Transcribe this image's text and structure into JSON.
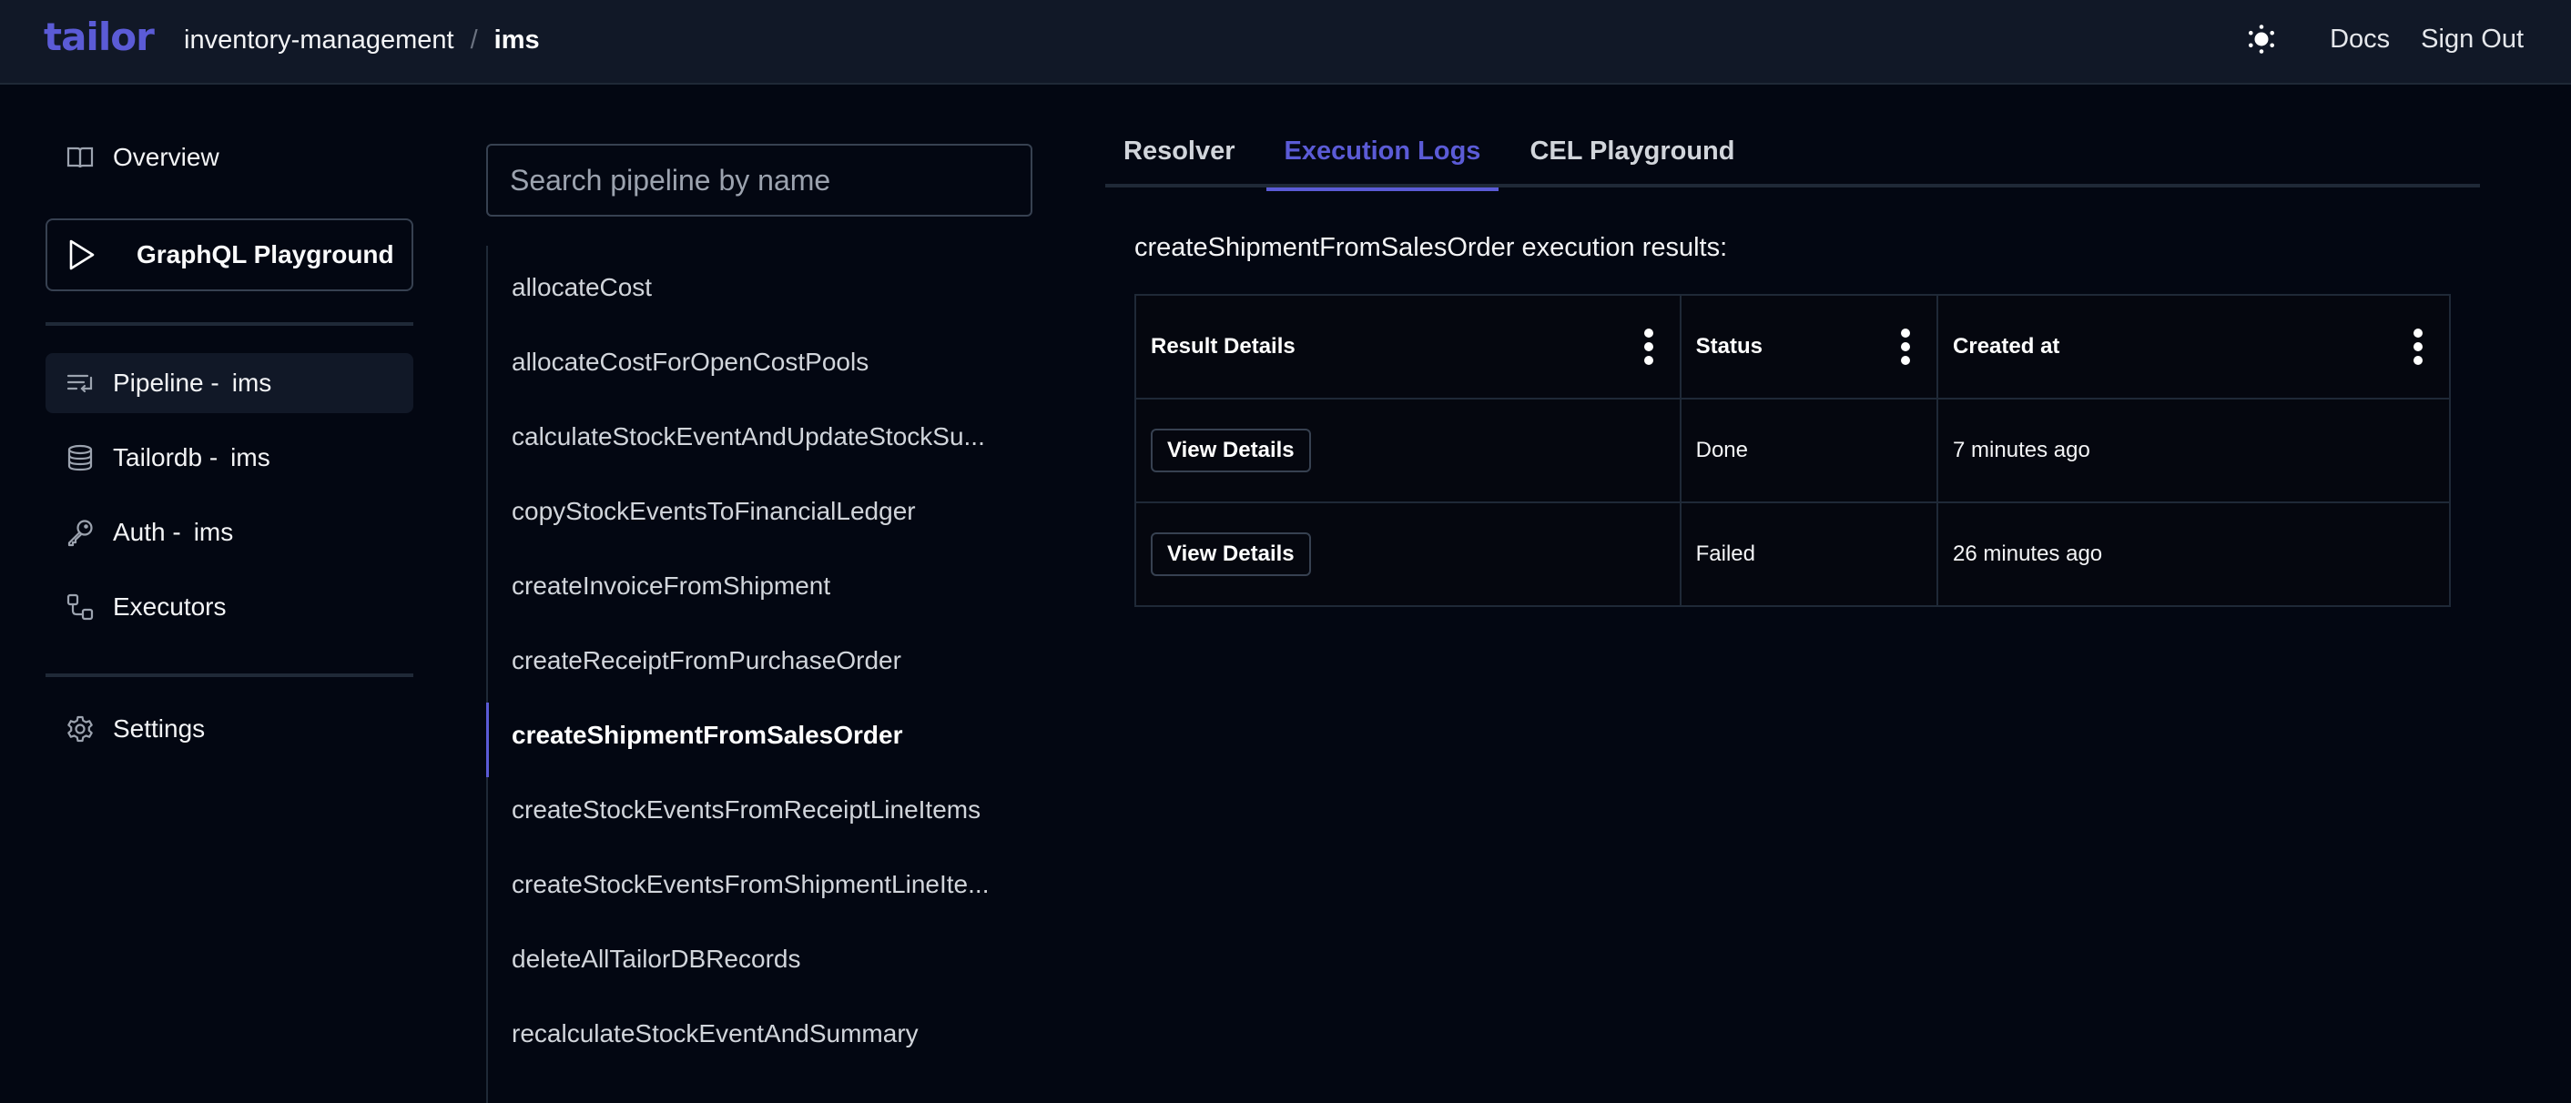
{
  "header": {
    "logo": "tailor",
    "breadcrumb": {
      "workspace": "inventory-management",
      "separator": "/",
      "current": "ims"
    },
    "theme_icon": "sun-icon",
    "links": {
      "docs": "Docs",
      "sign_out": "Sign Out"
    }
  },
  "sidebar": {
    "overview": {
      "label": "Overview",
      "icon": "book-open-icon"
    },
    "graphql": {
      "label": "GraphQL Playground",
      "icon": "play-icon"
    },
    "items": [
      {
        "label": "Pipeline -",
        "suffix": "ims",
        "icon": "list-return-icon",
        "active": true
      },
      {
        "label": "Tailordb -",
        "suffix": "ims",
        "icon": "database-icon",
        "active": false
      },
      {
        "label": "Auth -",
        "suffix": "ims",
        "icon": "key-icon",
        "active": false
      },
      {
        "label": "Executors",
        "suffix": "",
        "icon": "nodes-icon",
        "active": false
      }
    ],
    "settings": {
      "label": "Settings",
      "icon": "gear-icon"
    }
  },
  "pipelines": {
    "search_placeholder": "Search pipeline by name",
    "search_value": "",
    "items": [
      "allocateCost",
      "allocateCostForOpenCostPools",
      "calculateStockEventAndUpdateStockSu...",
      "copyStockEventsToFinancialLedger",
      "createInvoiceFromShipment",
      "createReceiptFromPurchaseOrder",
      "createShipmentFromSalesOrder",
      "createStockEventsFromReceiptLineItems",
      "createStockEventsFromShipmentLineIte...",
      "deleteAllTailorDBRecords",
      "recalculateStockEventAndSummary"
    ],
    "selected": "createShipmentFromSalesOrder"
  },
  "main": {
    "tabs": [
      {
        "label": "Resolver",
        "active": false
      },
      {
        "label": "Execution Logs",
        "active": true
      },
      {
        "label": "CEL Playground",
        "active": false
      }
    ],
    "results_title": "createShipmentFromSalesOrder execution results:",
    "table": {
      "columns": [
        "Result Details",
        "Status",
        "Created at"
      ],
      "rows": [
        {
          "action": "View Details",
          "status": "Done",
          "created_at": "7 minutes ago"
        },
        {
          "action": "View Details",
          "status": "Failed",
          "created_at": "26 minutes ago"
        }
      ]
    }
  },
  "colors": {
    "accent": "#5b5bd6",
    "background": "#030712",
    "header_bg": "#111827",
    "border": "#1f2937"
  }
}
